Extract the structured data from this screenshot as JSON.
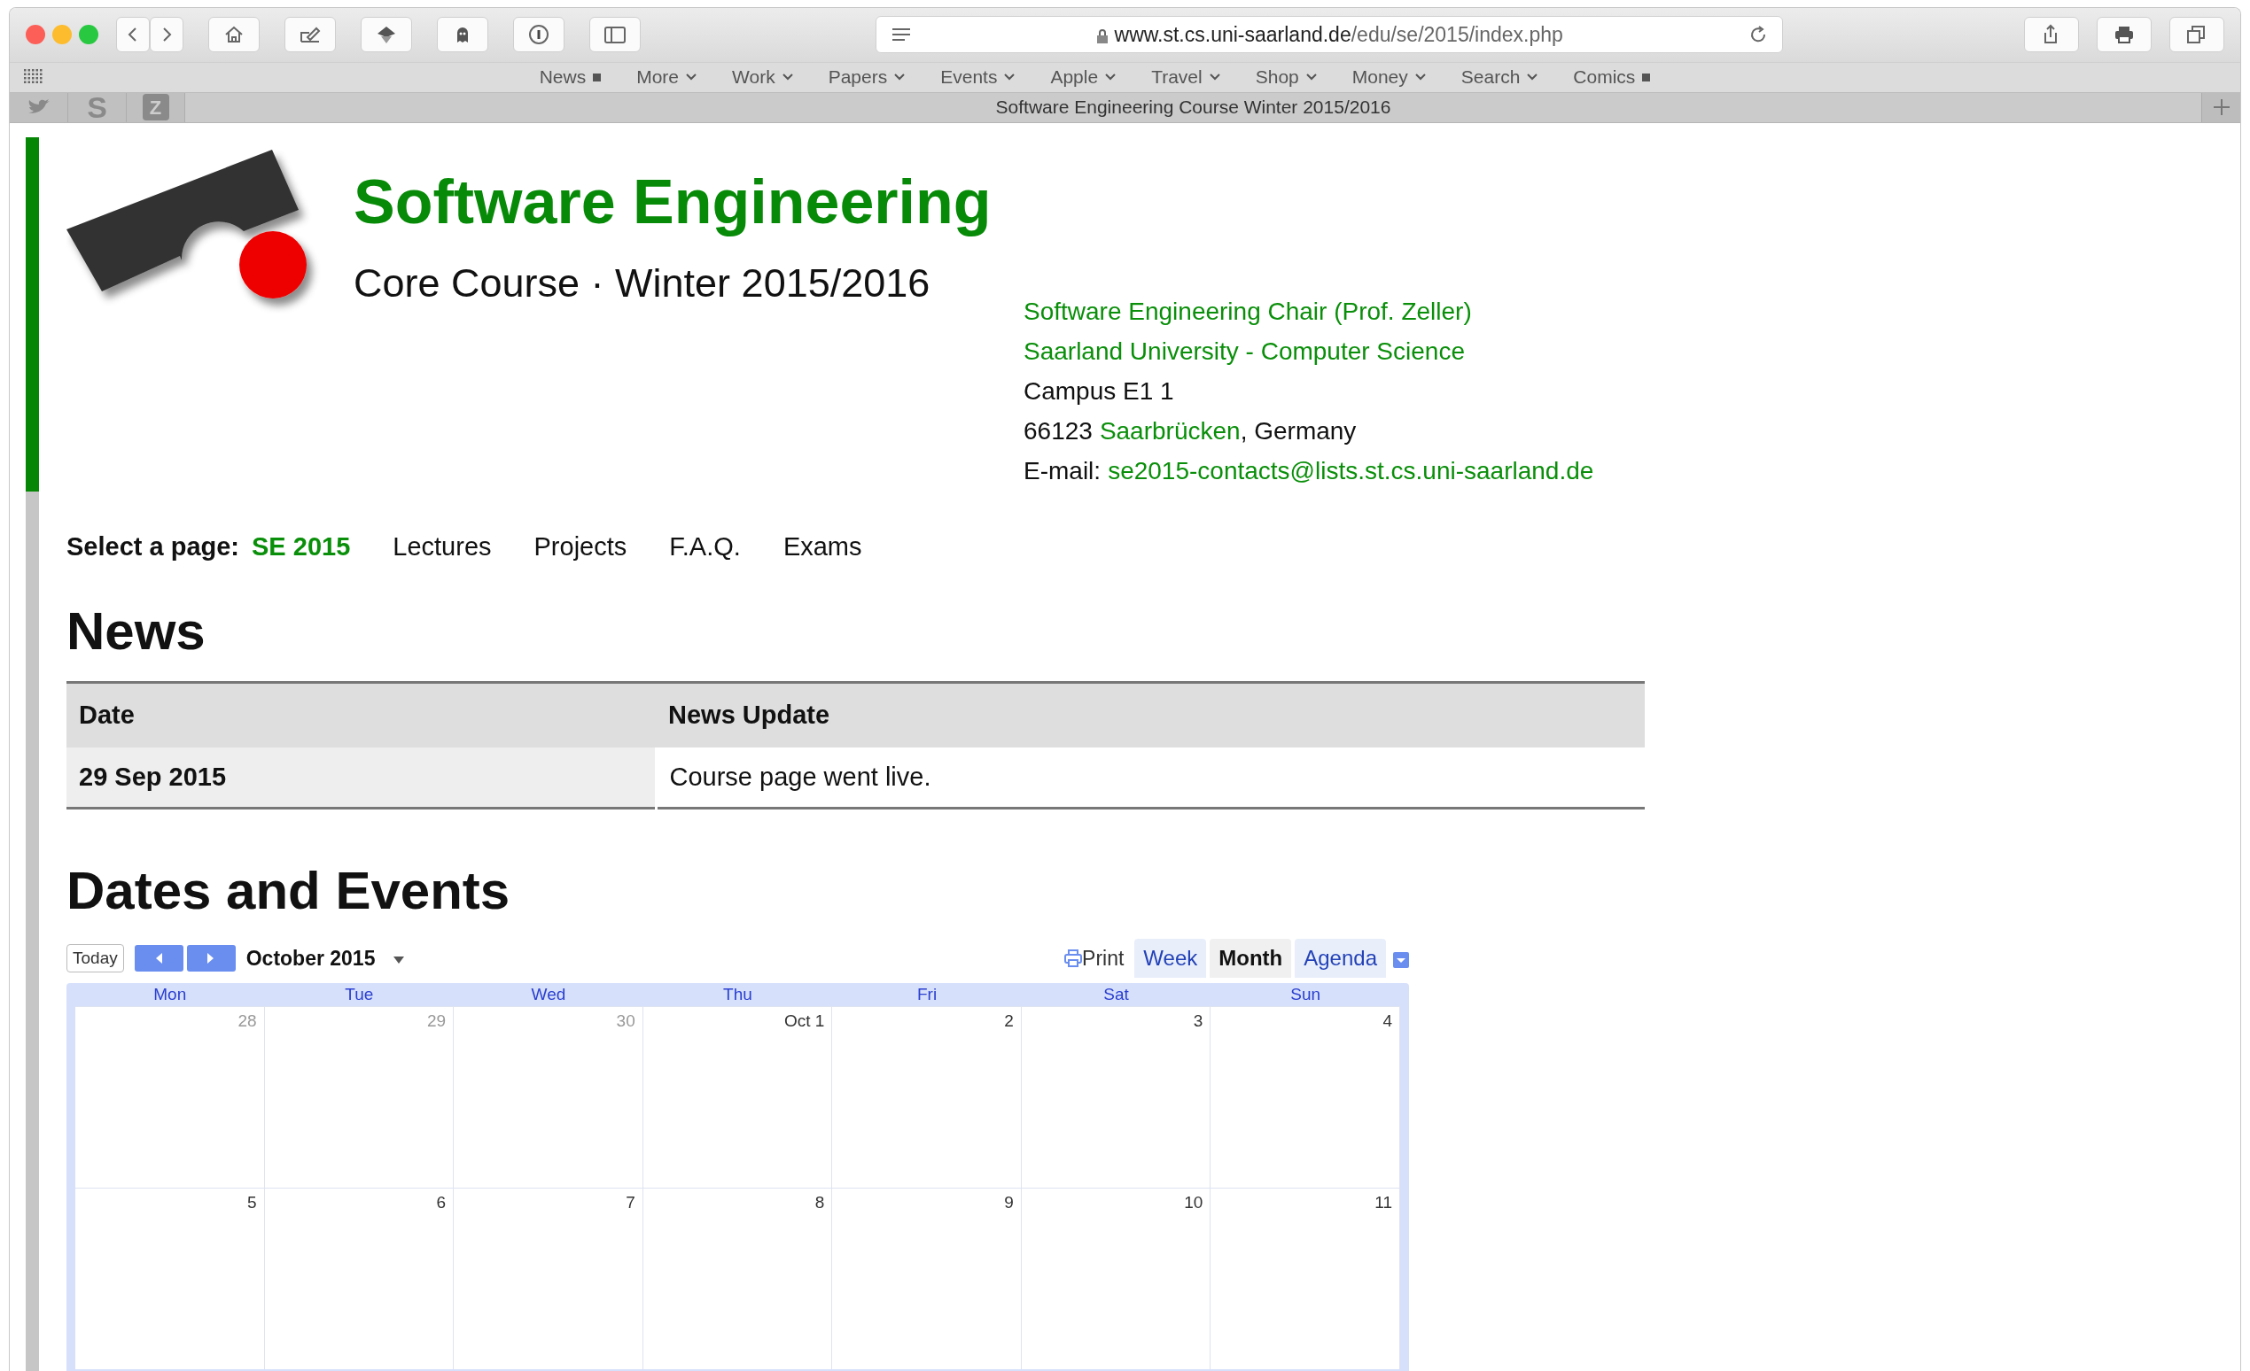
{
  "browser": {
    "url_host": "www.st.cs.uni-saarland.de",
    "url_path": "/edu/se/2015/index.php",
    "bookmarks": [
      {
        "label": "News",
        "kind": "square"
      },
      {
        "label": "More",
        "kind": "menu"
      },
      {
        "label": "Work",
        "kind": "menu"
      },
      {
        "label": "Papers",
        "kind": "menu"
      },
      {
        "label": "Events",
        "kind": "menu"
      },
      {
        "label": "Apple",
        "kind": "menu"
      },
      {
        "label": "Travel",
        "kind": "menu"
      },
      {
        "label": "Shop",
        "kind": "menu"
      },
      {
        "label": "Money",
        "kind": "menu"
      },
      {
        "label": "Search",
        "kind": "menu"
      },
      {
        "label": "Comics",
        "kind": "square"
      }
    ],
    "pinned_tabs": [
      {
        "label": "S"
      },
      {
        "label": "Z"
      }
    ],
    "tab_title": "Software Engineering Course Winter 2015/2016"
  },
  "header": {
    "title": "Software Engineering",
    "subtitle": "Core Course · Winter 2015/2016"
  },
  "address": [
    [
      {
        "text": "Software Engineering Chair (Prof. Zeller)",
        "link": true
      }
    ],
    [
      {
        "text": "Saarland University - Computer Science",
        "link": true
      }
    ],
    [
      {
        "text": "Campus E1 1",
        "link": false
      }
    ],
    [
      {
        "text": "66123",
        "link": false
      },
      {
        "text": "Saarbrücken",
        "link": true
      },
      {
        "text": ", Germany",
        "link": false
      }
    ],
    [
      {
        "text": "E-mail:",
        "link": false
      },
      {
        "text": "se2015-contacts@lists.st.cs.uni-saarland.de",
        "link": true
      }
    ]
  ],
  "nav": {
    "label": "Select a page:",
    "items": [
      {
        "label": "SE 2015",
        "selected": true
      },
      {
        "label": "Lectures",
        "selected": false
      },
      {
        "label": "Projects",
        "selected": false
      },
      {
        "label": "F.A.Q.",
        "selected": false
      },
      {
        "label": "Exams",
        "selected": false
      }
    ]
  },
  "news": {
    "heading": "News",
    "columns": [
      "Date",
      "News Update"
    ],
    "rows": [
      [
        "29 Sep 2015",
        "Course page went live."
      ]
    ]
  },
  "events": {
    "heading": "Dates and Events",
    "calendar": {
      "today_label": "Today",
      "month": "October 2015",
      "print_label": "Print",
      "views": [
        {
          "label": "Week",
          "selected": false
        },
        {
          "label": "Month",
          "selected": true
        },
        {
          "label": "Agenda",
          "selected": false
        }
      ],
      "weekdays": [
        "Mon",
        "Tue",
        "Wed",
        "Thu",
        "Fri",
        "Sat",
        "Sun"
      ],
      "weeks": [
        [
          {
            "label": "28",
            "other_month": true
          },
          {
            "label": "29",
            "other_month": true
          },
          {
            "label": "30",
            "other_month": true
          },
          {
            "label": "Oct 1",
            "other_month": false
          },
          {
            "label": "2",
            "other_month": false
          },
          {
            "label": "3",
            "other_month": false
          },
          {
            "label": "4",
            "other_month": false
          }
        ],
        [
          {
            "label": "5",
            "other_month": false
          },
          {
            "label": "6",
            "other_month": false
          },
          {
            "label": "7",
            "other_month": false
          },
          {
            "label": "8",
            "other_month": false
          },
          {
            "label": "9",
            "other_month": false
          },
          {
            "label": "10",
            "other_month": false
          },
          {
            "label": "11",
            "other_month": false
          }
        ]
      ]
    }
  }
}
